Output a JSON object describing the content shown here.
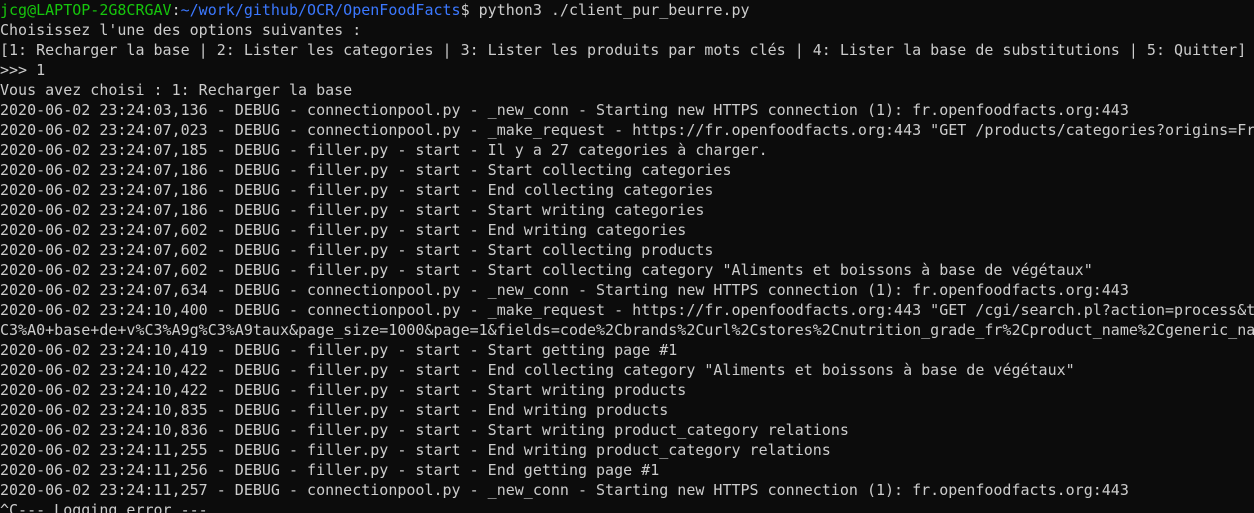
{
  "prompt": {
    "user": "jcg@LAPTOP-2G8CRGAV",
    "sep": ":",
    "path": "~/work/github/OCR/OpenFoodFacts",
    "sigil": "$ ",
    "command": "python3 ./client_pur_beurre.py"
  },
  "colors": {
    "background": "#0c0c0c",
    "text": "#cccccc",
    "user": "#16c60c",
    "path": "#3b78ff"
  },
  "lines": [
    "Choisissez l'une des options suivantes :",
    "[1: Recharger la base | 2: Lister les categories | 3: Lister les produits par mots clés | 4: Lister la base de substitutions | 5: Quitter]",
    ">>> 1",
    "Vous avez choisi : 1: Recharger la base",
    "2020-06-02 23:24:03,136 - DEBUG - connectionpool.py - _new_conn - Starting new HTTPS connection (1): fr.openfoodfacts.org:443",
    "2020-06-02 23:24:07,023 - DEBUG - connectionpool.py - _make_request - https://fr.openfoodfacts.org:443 \"GET /products/categories?origins=Fra",
    "2020-06-02 23:24:07,185 - DEBUG - filler.py - start - Il y a 27 categories à charger.",
    "2020-06-02 23:24:07,186 - DEBUG - filler.py - start - Start collecting categories",
    "2020-06-02 23:24:07,186 - DEBUG - filler.py - start - End collecting categories",
    "2020-06-02 23:24:07,186 - DEBUG - filler.py - start - Start writing categories",
    "2020-06-02 23:24:07,602 - DEBUG - filler.py - start - End writing categories",
    "2020-06-02 23:24:07,602 - DEBUG - filler.py - start - Start collecting products",
    "2020-06-02 23:24:07,602 - DEBUG - filler.py - start - Start collecting category \"Aliments et boissons à base de végétaux\"",
    "2020-06-02 23:24:07,634 - DEBUG - connectionpool.py - _new_conn - Starting new HTTPS connection (1): fr.openfoodfacts.org:443",
    "2020-06-02 23:24:10,400 - DEBUG - connectionpool.py - _make_request - https://fr.openfoodfacts.org:443 \"GET /cgi/search.pl?action=process&ta",
    "C3%A0+base+de+v%C3%A9g%C3%A9taux&page_size=1000&page=1&fields=code%2Cbrands%2Curl%2Cstores%2Cnutrition_grade_fr%2Cproduct_name%2Cgeneric_nam",
    "2020-06-02 23:24:10,419 - DEBUG - filler.py - start - Start getting page #1",
    "2020-06-02 23:24:10,422 - DEBUG - filler.py - start - End collecting category \"Aliments et boissons à base de végétaux\"",
    "2020-06-02 23:24:10,422 - DEBUG - filler.py - start - Start writing products",
    "2020-06-02 23:24:10,835 - DEBUG - filler.py - start - End writing products",
    "2020-06-02 23:24:10,836 - DEBUG - filler.py - start - Start writing product_category relations",
    "2020-06-02 23:24:11,255 - DEBUG - filler.py - start - End writing product_category relations",
    "2020-06-02 23:24:11,256 - DEBUG - filler.py - start - End getting page #1",
    "2020-06-02 23:24:11,257 - DEBUG - connectionpool.py - _new_conn - Starting new HTTPS connection (1): fr.openfoodfacts.org:443",
    "^C--- Logging error ---"
  ]
}
